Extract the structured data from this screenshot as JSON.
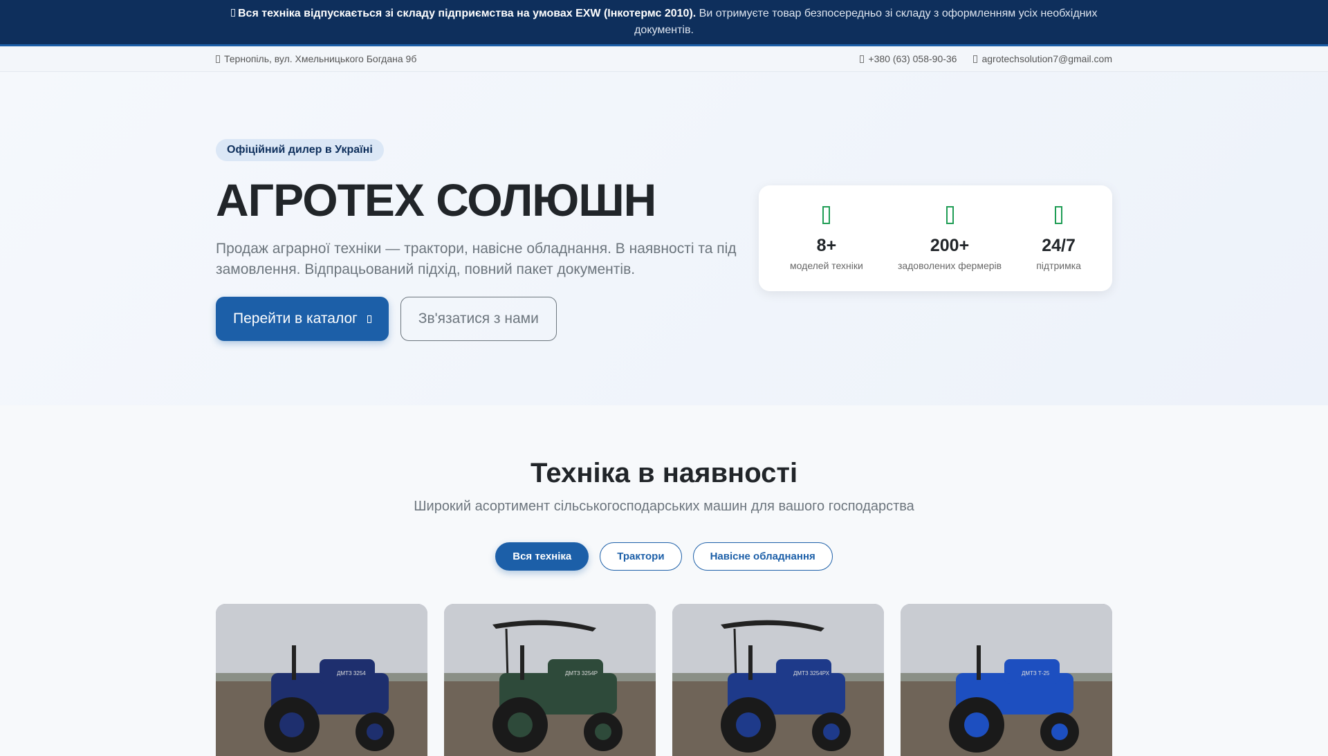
{
  "notice": {
    "bold": "Вся техніка відпускається зі складу підприємства на умовах EXW (Інкотермс 2010).",
    "text": " Ви отримуєте товар безпосередньо зі складу з оформленням усіх необхідних документів."
  },
  "contacts": {
    "address": "Тернопіль, вул. Хмельницького Богдана 9б",
    "phone": "+380 (63) 058-90-36",
    "email": "agrotechsolution7@gmail.com"
  },
  "hero": {
    "badge": "Офіційний дилер в Україні",
    "title": "АГРОТЕХ СОЛЮШН",
    "lead": "Продаж аграрної техніки — трактори, навісне обладнання. В наявності та під замовлення. Відпрацьований підхід, повний пакет документів.",
    "catalog_button": "Перейти в каталог",
    "contact_button": "Зв'язатися з нами"
  },
  "stats": [
    {
      "value": "8+",
      "label": "моделей техніки"
    },
    {
      "value": "200+",
      "label": "задоволених фермерів"
    },
    {
      "value": "24/7",
      "label": "підтримка"
    }
  ],
  "catalog": {
    "title": "Техніка в наявності",
    "subtitle": "Широкий асортимент сільськогосподарських машин для вашого господарства",
    "filters": [
      "Вся техніка",
      "Трактори",
      "Навісне обладнання"
    ]
  },
  "products": [
    {
      "color": "#1e2f6e",
      "label": "ДМТЗ 3254"
    },
    {
      "color": "#2e4a3a",
      "label": "ДМТЗ 3254Р"
    },
    {
      "color": "#1e3a8a",
      "label": "ДМТЗ 3254РХ"
    },
    {
      "color": "#1d4fc0",
      "label": "ДМТЗ Т-25"
    }
  ]
}
